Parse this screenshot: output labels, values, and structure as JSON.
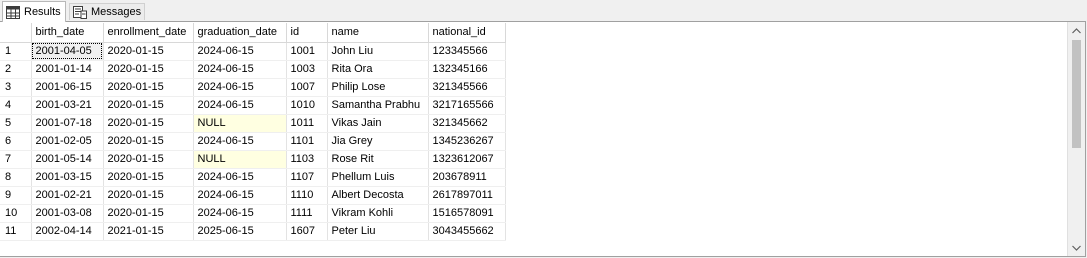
{
  "tabs": {
    "results": {
      "label": "Results"
    },
    "messages": {
      "label": "Messages"
    }
  },
  "columns": [
    "birth_date",
    "enrollment_date",
    "graduation_date",
    "id",
    "name",
    "national_id"
  ],
  "rows": [
    {
      "num": "1",
      "birth_date": "2001-04-05",
      "enrollment_date": "2020-01-15",
      "graduation_date": "2024-06-15",
      "id": "1001",
      "name": "John Liu",
      "national_id": "123345566"
    },
    {
      "num": "2",
      "birth_date": "2001-01-14",
      "enrollment_date": "2020-01-15",
      "graduation_date": "2024-06-15",
      "id": "1003",
      "name": "Rita Ora",
      "national_id": "132345166"
    },
    {
      "num": "3",
      "birth_date": "2001-06-15",
      "enrollment_date": "2020-01-15",
      "graduation_date": "2024-06-15",
      "id": "1007",
      "name": "Philip Lose",
      "national_id": "321345566"
    },
    {
      "num": "4",
      "birth_date": "2001-03-21",
      "enrollment_date": "2020-01-15",
      "graduation_date": "2024-06-15",
      "id": "1010",
      "name": "Samantha Prabhu",
      "national_id": "3217165566"
    },
    {
      "num": "5",
      "birth_date": "2001-07-18",
      "enrollment_date": "2020-01-15",
      "graduation_date": "NULL",
      "id": "1011",
      "name": "Vikas Jain",
      "national_id": "321345662"
    },
    {
      "num": "6",
      "birth_date": "2001-02-05",
      "enrollment_date": "2020-01-15",
      "graduation_date": "2024-06-15",
      "id": "1101",
      "name": "Jia Grey",
      "national_id": "1345236267"
    },
    {
      "num": "7",
      "birth_date": "2001-05-14",
      "enrollment_date": "2020-01-15",
      "graduation_date": "NULL",
      "id": "1103",
      "name": "Rose Rit",
      "national_id": "1323612067"
    },
    {
      "num": "8",
      "birth_date": "2001-03-15",
      "enrollment_date": "2020-01-15",
      "graduation_date": "2024-06-15",
      "id": "1107",
      "name": "Phellum Luis",
      "national_id": "203678911"
    },
    {
      "num": "9",
      "birth_date": "2001-02-21",
      "enrollment_date": "2020-01-15",
      "graduation_date": "2024-06-15",
      "id": "1110",
      "name": "Albert Decosta",
      "national_id": "2617897011"
    },
    {
      "num": "10",
      "birth_date": "2001-03-08",
      "enrollment_date": "2020-01-15",
      "graduation_date": "2024-06-15",
      "id": "1111",
      "name": "Vikram Kohli",
      "national_id": "1516578091"
    },
    {
      "num": "11",
      "birth_date": "2002-04-14",
      "enrollment_date": "2021-01-15",
      "graduation_date": "2025-06-15",
      "id": "1607",
      "name": "Peter Liu",
      "national_id": "3043455662"
    }
  ],
  "null_highlight_color": "#ffffe1",
  "selected_cell": {
    "row": 0,
    "column": "birth_date"
  },
  "icons": {
    "results_tab": "grid-icon",
    "messages_tab": "messages-icon",
    "scroll_up": "chevron-up-icon",
    "scroll_down": "chevron-down-icon"
  }
}
